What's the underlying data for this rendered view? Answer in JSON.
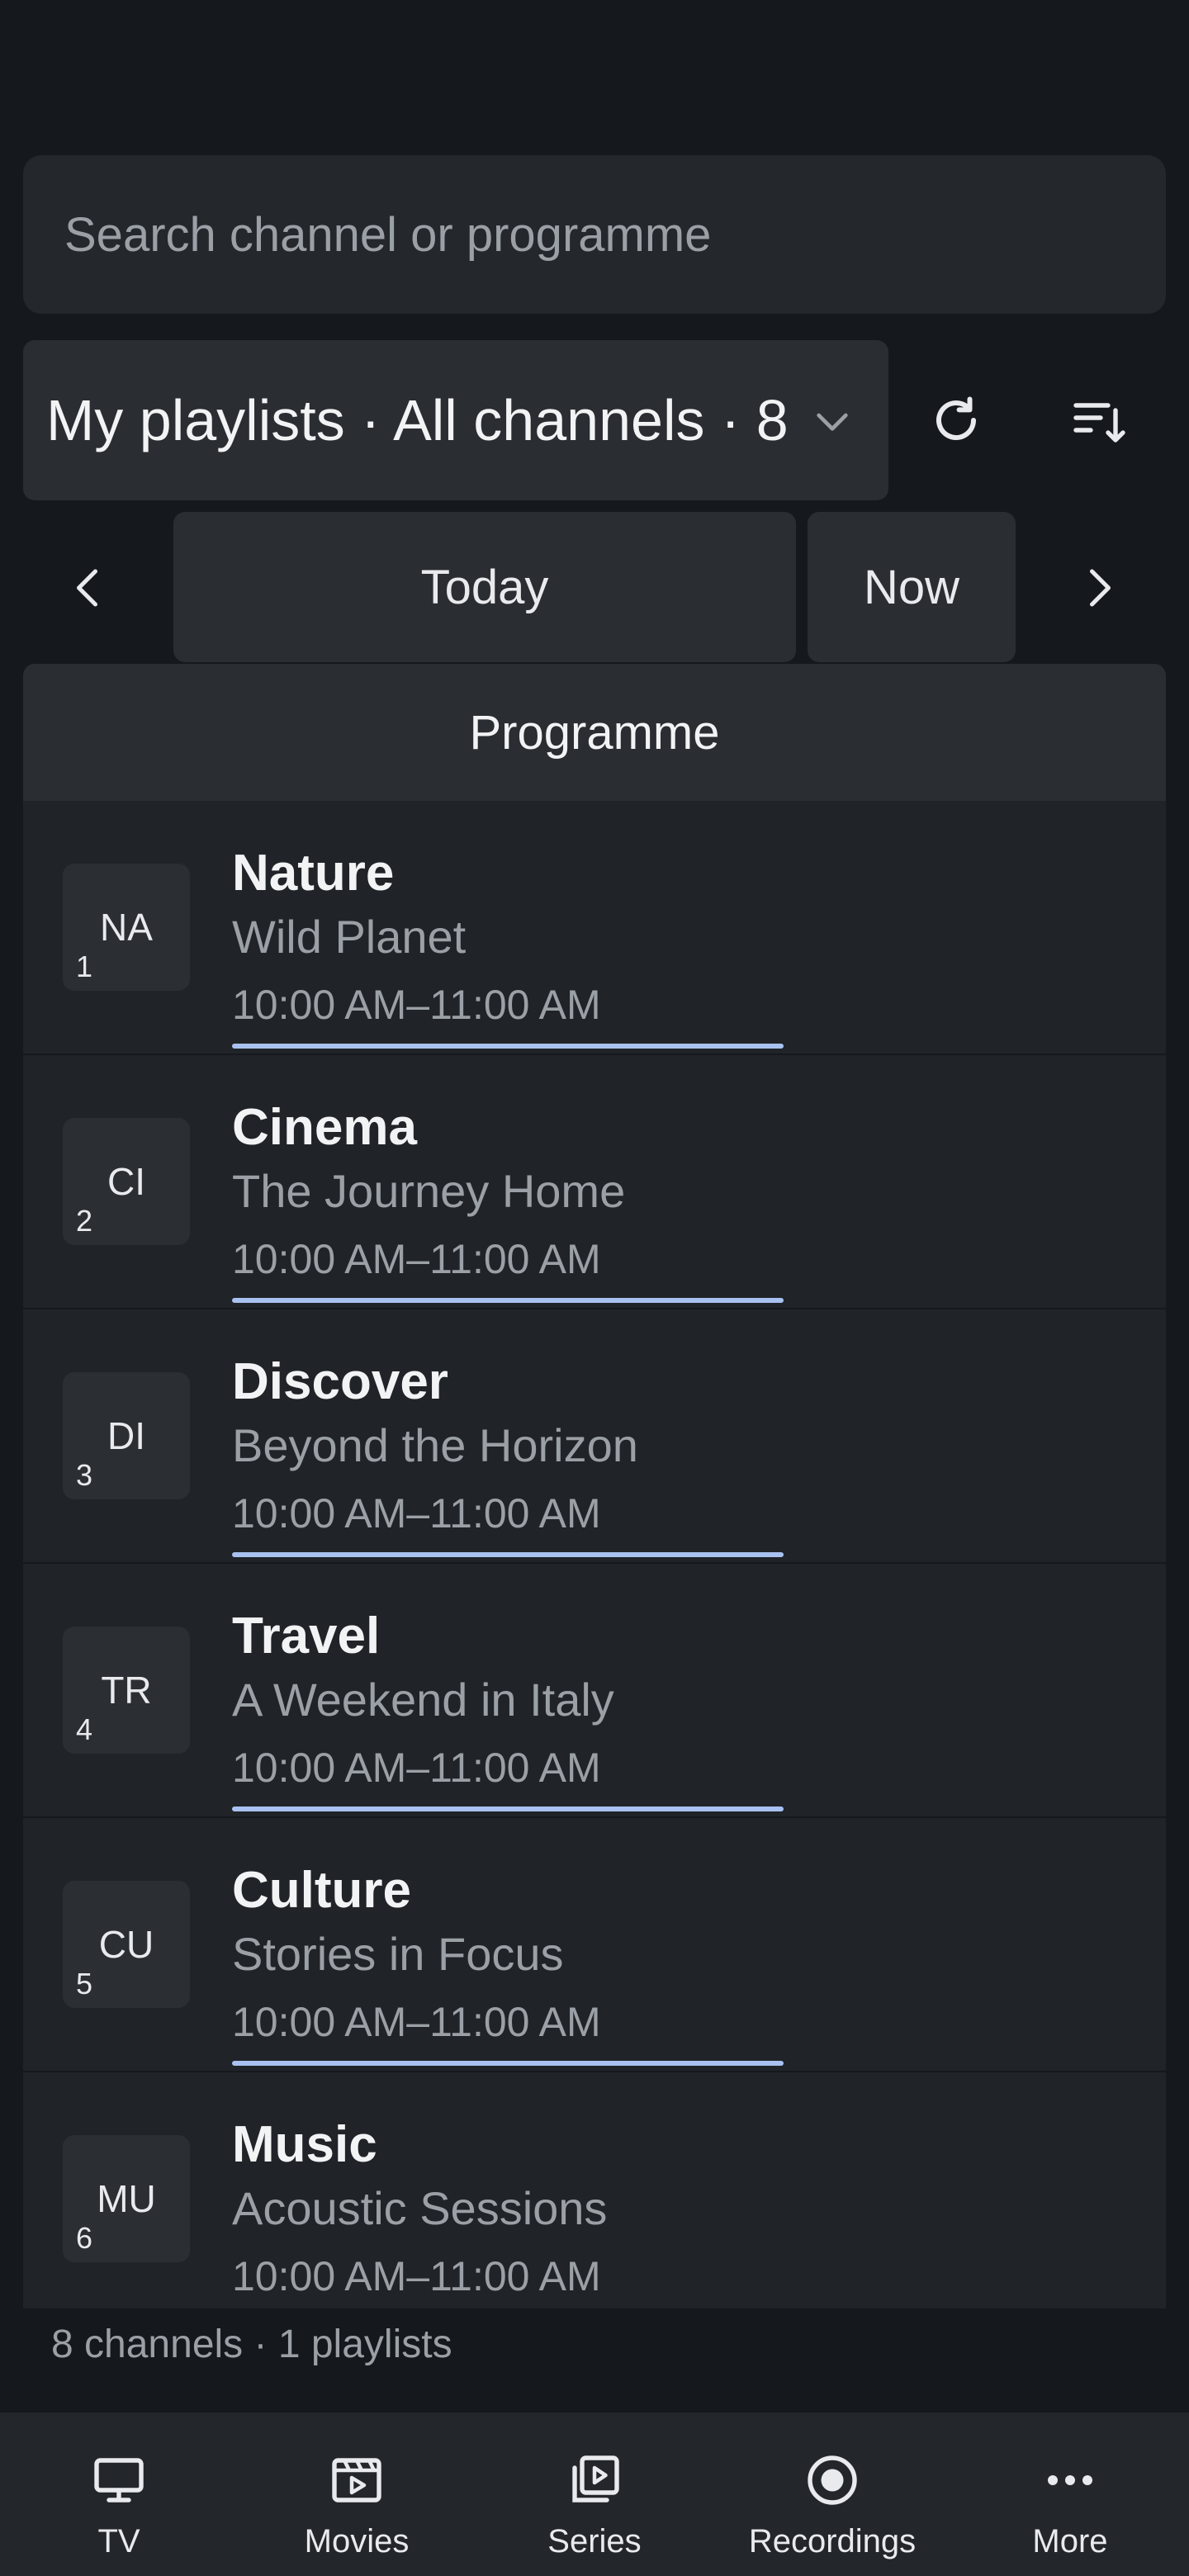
{
  "search": {
    "placeholder": "Search channel or programme",
    "value": ""
  },
  "playlist": {
    "label": "My playlists · All channels · 8"
  },
  "date_nav": {
    "today_label": "Today",
    "now_label": "Now"
  },
  "programme_header": "Programme",
  "channels": [
    {
      "abbr": "NA",
      "num": "1",
      "name": "Nature",
      "title": "Wild Planet",
      "time": "10:00 AM–11:00 AM",
      "progress": 0.48
    },
    {
      "abbr": "CI",
      "num": "2",
      "name": "Cinema",
      "title": "The Journey Home",
      "time": "10:00 AM–11:00 AM",
      "progress": 0.48
    },
    {
      "abbr": "DI",
      "num": "3",
      "name": "Discover",
      "title": "Beyond the Horizon",
      "time": "10:00 AM–11:00 AM",
      "progress": 0.48
    },
    {
      "abbr": "TR",
      "num": "4",
      "name": "Travel",
      "title": "A Weekend in Italy",
      "time": "10:00 AM–11:00 AM",
      "progress": 0.48
    },
    {
      "abbr": "CU",
      "num": "5",
      "name": "Culture",
      "title": "Stories in Focus",
      "time": "10:00 AM–11:00 AM",
      "progress": 0.48
    },
    {
      "abbr": "MU",
      "num": "6",
      "name": "Music",
      "title": "Acoustic Sessions",
      "time": "10:00 AM–11:00 AM",
      "progress": 0.48
    }
  ],
  "footer": "8 channels · 1 playlists",
  "bottom_nav": [
    {
      "label": "TV",
      "icon": "tv-icon"
    },
    {
      "label": "Movies",
      "icon": "movies-icon"
    },
    {
      "label": "Series",
      "icon": "series-icon"
    },
    {
      "label": "Recordings",
      "icon": "recordings-icon"
    },
    {
      "label": "More",
      "icon": "more-icon"
    }
  ],
  "colors": {
    "background": "#15181c",
    "surface": "#24272b",
    "accent_progress": "#a8c1f0"
  }
}
